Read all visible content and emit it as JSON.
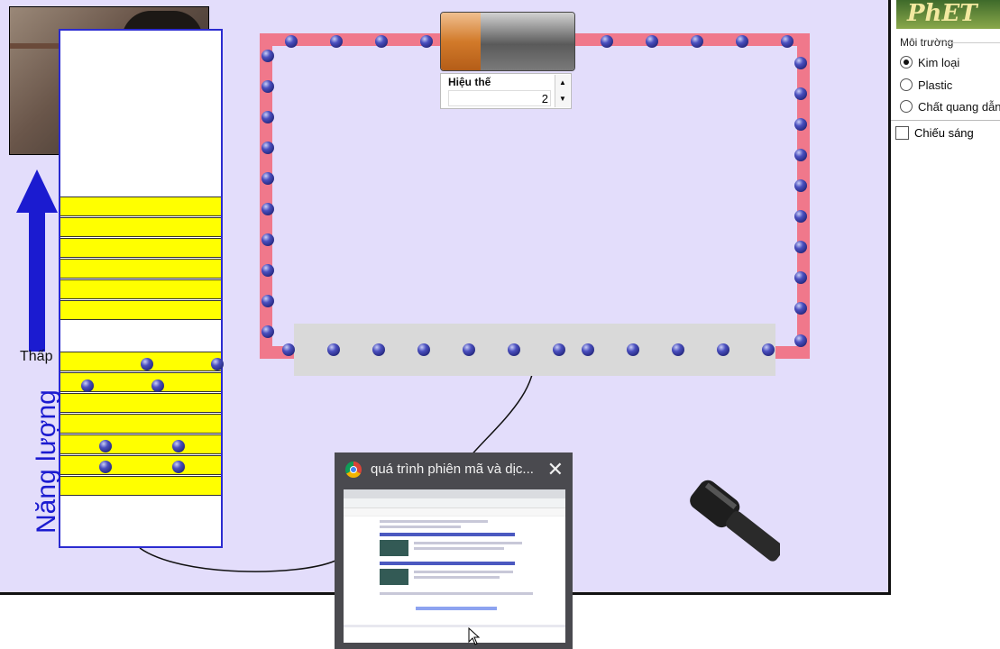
{
  "panel": {
    "logo_text": "PhET",
    "environment_label": "Môi trường",
    "environment_options": [
      {
        "label": "Kim loại",
        "selected": true
      },
      {
        "label": "Plastic",
        "selected": false
      },
      {
        "label": "Chất quang dẫn",
        "selected": false
      }
    ],
    "illumination_label": "Chiếu sáng",
    "illumination_checked": false
  },
  "energy_diagram": {
    "low_label": "Thấp",
    "axis_label": "Năng lượng"
  },
  "battery": {
    "voltage_label": "Hiệu thế",
    "voltage_value": "2"
  },
  "popup": {
    "title": "quá trình phiên mã và dịc...",
    "close_icon": "close-icon",
    "browser_icon": "chrome-icon"
  },
  "colors": {
    "sim_background": "#e3ddfb",
    "wire": "#f0788b",
    "band": "#ffff00",
    "electron": "#3a3fa8",
    "energy_arrow": "#1b1bd0"
  }
}
